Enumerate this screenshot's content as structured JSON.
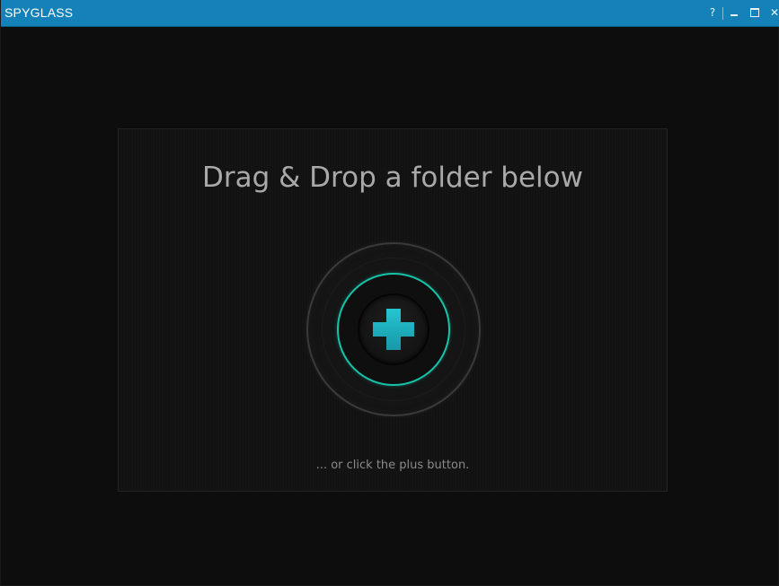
{
  "window": {
    "title": "SPYGLASS",
    "help_label": "?",
    "close_label": "✕"
  },
  "drop_zone": {
    "heading": "Drag & Drop a folder below",
    "hint": "... or click the plus button."
  },
  "colors": {
    "titlebar": "#1481b8",
    "background": "#0d0d0d",
    "accent": "#17c3a8",
    "plus": "#1fb2c0"
  },
  "icons": {
    "add": "plus-icon"
  }
}
